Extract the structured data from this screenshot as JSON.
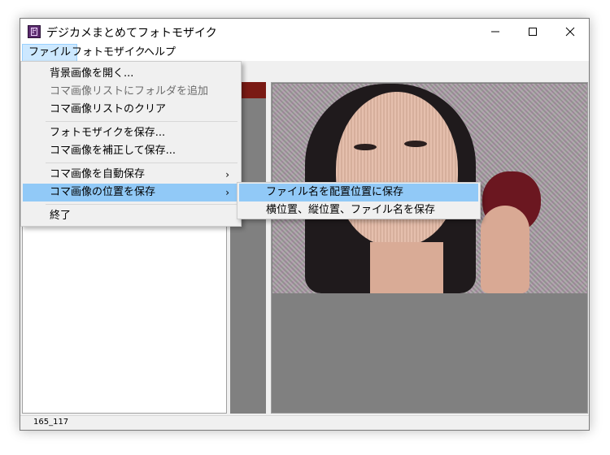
{
  "window": {
    "title": "デジカメまとめてフォトモザイク",
    "icon_letter": "F"
  },
  "menubar": {
    "items": [
      {
        "label": "ファイル"
      },
      {
        "label": "フォトモザイク"
      },
      {
        "label": "ヘルプ"
      }
    ]
  },
  "file_menu": {
    "items": [
      {
        "label": "背景画像を開く..."
      },
      {
        "label": "コマ画像リストにフォルダを追加"
      },
      {
        "label": "コマ画像リストのクリア"
      },
      {
        "label": "フォトモザイクを保存..."
      },
      {
        "label": "コマ画像を補正して保存..."
      },
      {
        "label": "コマ画像を自動保存",
        "arrow": "›"
      },
      {
        "label": "コマ画像の位置を保存",
        "arrow": "›"
      },
      {
        "label": "終了"
      }
    ]
  },
  "submenu": {
    "items": [
      {
        "label": "ファイル名を配置位置に保存"
      },
      {
        "label": "横位置、縦位置、ファイル名を保存"
      }
    ]
  },
  "statusbar": {
    "text": "165_117"
  },
  "colors": {
    "menu_highlight": "#91c9f7",
    "menubar_active": "#cce8ff",
    "canvas_bg": "#808080"
  }
}
